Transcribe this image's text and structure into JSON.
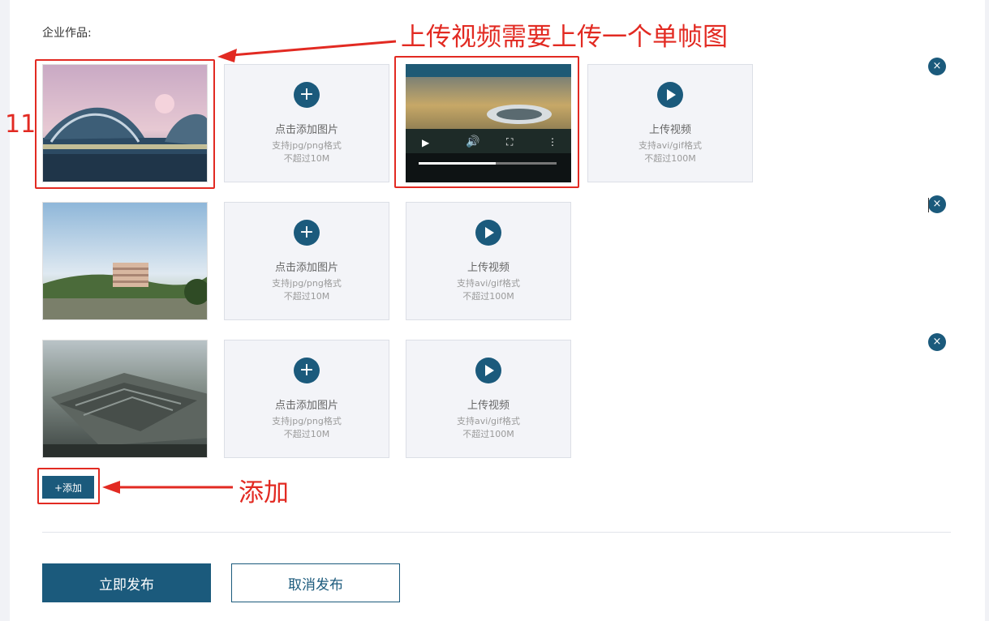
{
  "section": {
    "label": "企业作品:"
  },
  "upload_image": {
    "title": "点击添加图片",
    "formats": "支持jpg/png格式",
    "limit": "不超过10M",
    "icon": "plus-icon"
  },
  "upload_video": {
    "title": "上传视频",
    "formats": "支持avi/gif格式",
    "limit": "不超过100M",
    "icon": "play-icon"
  },
  "rows": [
    {
      "photo": "stadium-rendering",
      "has_video": true,
      "video_progress": 0.56
    },
    {
      "photo": "campus-building-rendering",
      "has_video": false
    },
    {
      "photo": "aerial-complex-rendering",
      "has_video": false
    }
  ],
  "remove": {
    "glyph": "×"
  },
  "add_button": {
    "label": "+添加"
  },
  "actions": {
    "publish": "立即发布",
    "cancel": "取消发布"
  },
  "annotations": {
    "top_note": "上传视频需要上传一个单帧图",
    "add_note": "添加",
    "side_number": "11"
  },
  "colors": {
    "primary": "#1b5a7c",
    "annotation_red": "#e22a22"
  }
}
